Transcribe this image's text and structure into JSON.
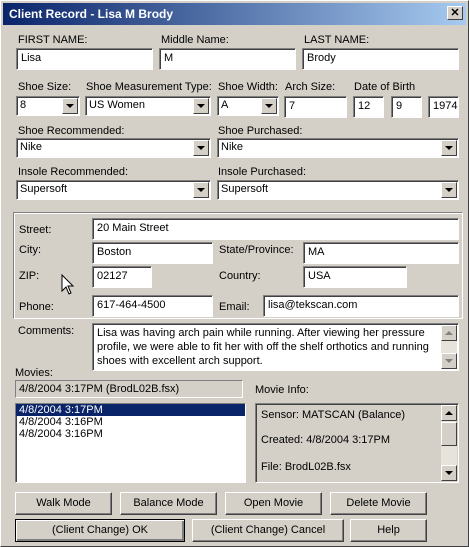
{
  "window": {
    "title": "Client Record - Lisa M Brody",
    "close_glyph": "✕"
  },
  "name": {
    "first_label": "FIRST NAME:",
    "first_value": "Lisa",
    "middle_label": "Middle Name:",
    "middle_value": "M",
    "last_label": "LAST NAME:",
    "last_value": "Brody"
  },
  "shoe": {
    "size_label": "Shoe Size:",
    "size_value": "8",
    "measurement_label": "Shoe Measurement Type:",
    "measurement_value": "US Women",
    "width_label": "Shoe Width:",
    "width_value": "A",
    "arch_label": "Arch Size:",
    "arch_value": "7",
    "dob_label": "Date of Birth",
    "dob_month": "12",
    "dob_day": "9",
    "dob_year": "1974",
    "recommended_label": "Shoe Recommended:",
    "recommended_value": "Nike",
    "purchased_label": "Shoe Purchased:",
    "purchased_value": "Nike"
  },
  "insole": {
    "recommended_label": "Insole Recommended:",
    "recommended_value": "Supersoft",
    "purchased_label": "Insole Purchased:",
    "purchased_value": "Supersoft"
  },
  "address": {
    "street_label": "Street:",
    "street_value": "20 Main Street",
    "city_label": "City:",
    "city_value": "Boston",
    "state_label": "State/Province:",
    "state_value": "MA",
    "zip_label": "ZIP:",
    "zip_value": "02127",
    "country_label": "Country:",
    "country_value": "USA",
    "phone_label": "Phone:",
    "phone_value": "617-464-4500",
    "email_label": "Email:",
    "email_value": "lisa@tekscan.com"
  },
  "comments": {
    "label": "Comments:",
    "lines": [
      "Lisa was having arch pain while running.  After viewing her pressure",
      "profile, we were able to fit her with off the shelf orthotics and running",
      "shoes with excellent arch support."
    ]
  },
  "movies": {
    "label": "Movies:",
    "current": "4/8/2004 3:17PM (BrodL02B.fsx)",
    "items": [
      "4/8/2004 3:17PM",
      "4/8/2004 3:16PM",
      "4/8/2004 3:16PM"
    ],
    "info_label": "Movie Info:",
    "info_lines": [
      "Sensor: MATSCAN (Balance)",
      "Created: 4/8/2004 3:17PM",
      "File: BrodL02B.fsx"
    ]
  },
  "buttons": {
    "walk_mode": "Walk Mode",
    "balance_mode": "Balance Mode",
    "open_movie": "Open Movie",
    "delete_movie": "Delete Movie",
    "ok": "(Client Change) OK",
    "cancel": "(Client Change) Cancel",
    "help": "Help"
  }
}
